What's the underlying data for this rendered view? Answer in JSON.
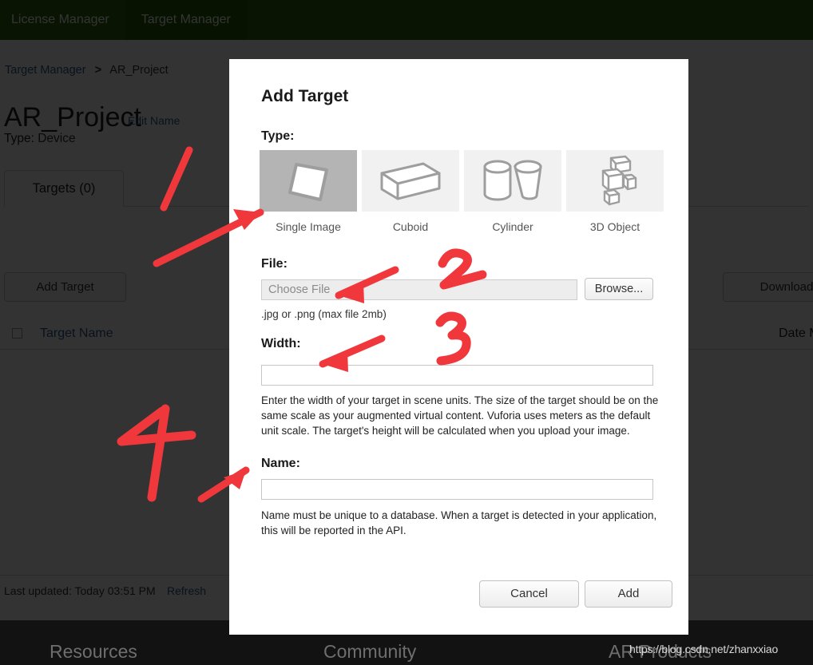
{
  "topnav": {
    "items": [
      {
        "label": "License Manager",
        "active": false
      },
      {
        "label": "Target Manager",
        "active": true
      }
    ]
  },
  "breadcrumb": {
    "root": "Target Manager",
    "separator": ">",
    "current": "AR_Project"
  },
  "project": {
    "title": "AR_Project",
    "edit_name_link": "Edit Name",
    "type_label": "Type:",
    "type_value": "Device"
  },
  "tabs": [
    {
      "label": "Targets (0)",
      "active": true
    }
  ],
  "toolbar": {
    "add_target_label": "Add Target",
    "download_database_label": "Download D"
  },
  "table": {
    "columns": [
      "Target Name",
      "Date M"
    ],
    "rows": []
  },
  "status": {
    "last_updated": "Last updated: Today 03:51 PM",
    "refresh_label": "Refresh"
  },
  "footer": {
    "columns": [
      "Resources",
      "Community",
      "AR Products"
    ],
    "watermark": "https://blog.csdn.net/zhanxxiao"
  },
  "modal": {
    "title": "Add Target",
    "type": {
      "label": "Type:",
      "options": [
        {
          "label": "Single Image",
          "icon": "single-image-icon",
          "selected": true
        },
        {
          "label": "Cuboid",
          "icon": "cuboid-icon",
          "selected": false
        },
        {
          "label": "Cylinder",
          "icon": "cylinder-icon",
          "selected": false
        },
        {
          "label": "3D Object",
          "icon": "3d-object-icon",
          "selected": false
        }
      ]
    },
    "file": {
      "label": "File:",
      "placeholder": "Choose File",
      "value": "",
      "browse_label": "Browse...",
      "hint": ".jpg or .png (max file 2mb)"
    },
    "width": {
      "label": "Width:",
      "value": "",
      "help": "Enter the width of your target in scene units. The size of the target should be on the same scale as your augmented virtual content. Vuforia uses meters as the default unit scale. The target's height will be calculated when you upload your image."
    },
    "name": {
      "label": "Name:",
      "value": "",
      "help": "Name must be unique to a database. When a target is detected in your application, this will be reported in the API."
    },
    "cancel_label": "Cancel",
    "add_label": "Add"
  },
  "annotations": {
    "color": "#f0383c",
    "marks": [
      {
        "name": "mark-1",
        "text": "1"
      },
      {
        "name": "mark-2",
        "text": "2"
      },
      {
        "name": "mark-3",
        "text": "3"
      },
      {
        "name": "mark-4",
        "text": "4"
      }
    ]
  },
  "colors": {
    "nav_green": "#2d6a0a",
    "link_blue": "#2c5d8f",
    "annotation_red": "#f0383c",
    "overlay": "rgba(0,0,0,0.80)"
  }
}
